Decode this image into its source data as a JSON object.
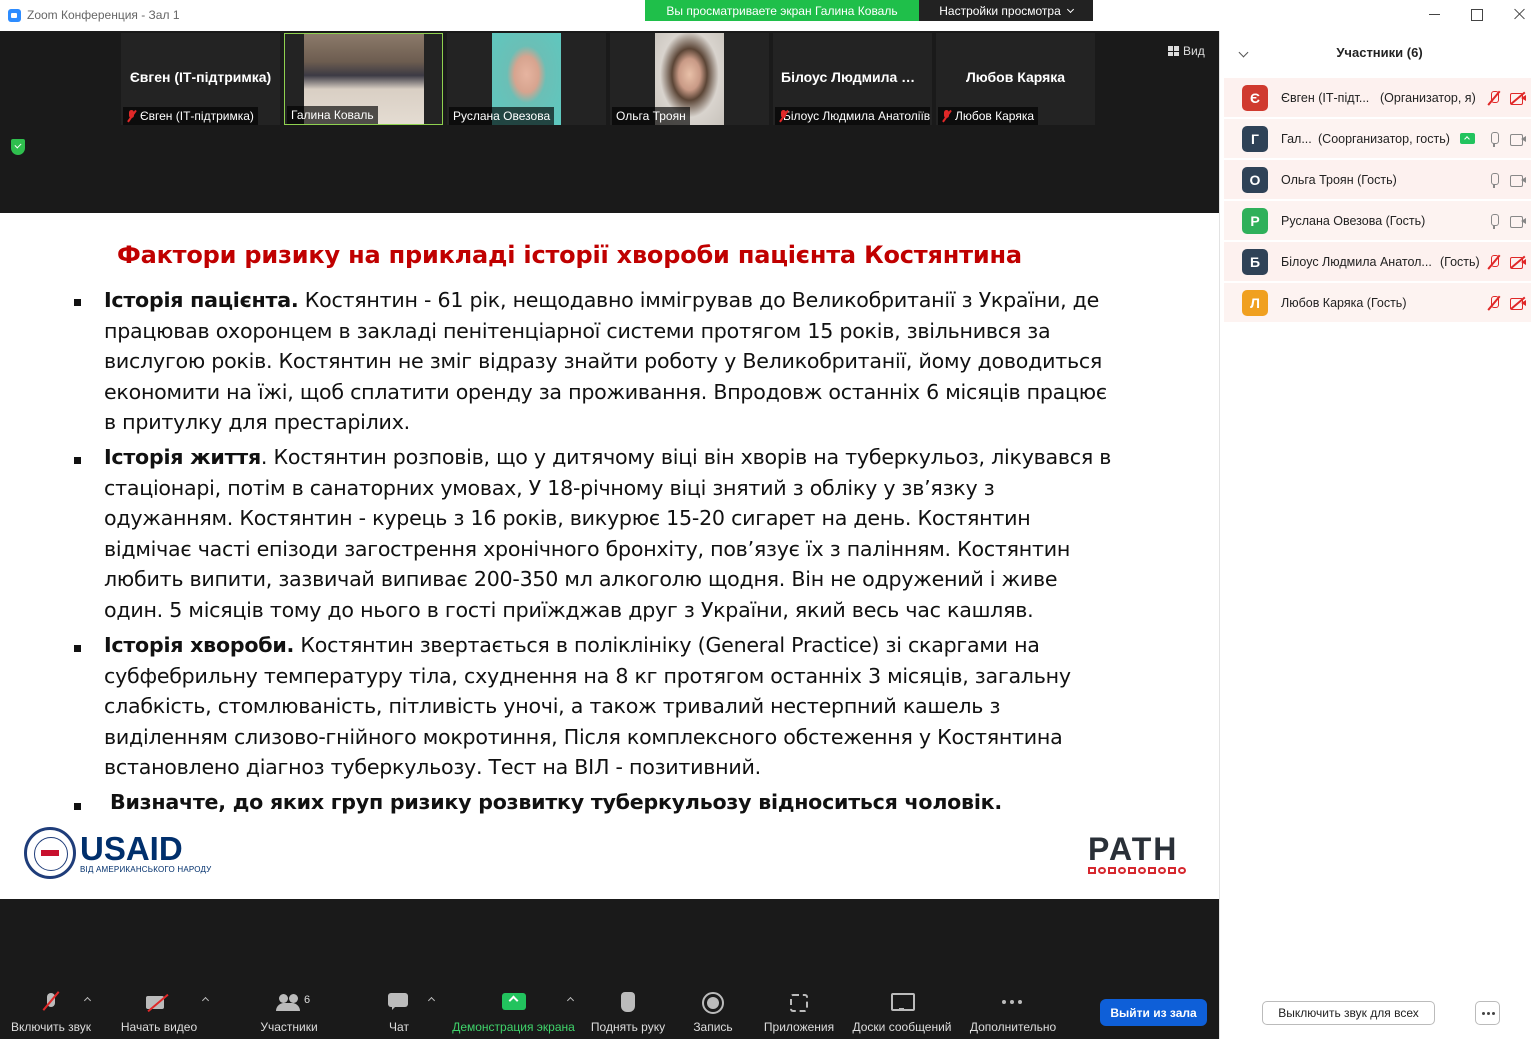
{
  "window": {
    "title": "Zoom Конференция - Зал 1",
    "share_banner": "Вы просматриваете экран Галина Коваль",
    "view_settings": "Настройки просмотра",
    "view_button": "Вид"
  },
  "video_tiles": [
    {
      "big_name": "Євген (ІТ-підтримка)",
      "label": "Євген (ІТ-підтримка)",
      "muted": true,
      "photo": false
    },
    {
      "big_name": "",
      "label": "Галина Коваль",
      "muted": false,
      "photo": true,
      "active": true
    },
    {
      "big_name": "",
      "label": "Руслана Овезова",
      "muted": false,
      "photo": true
    },
    {
      "big_name": "",
      "label": "Ольга Троян",
      "muted": false,
      "photo": true
    },
    {
      "big_name": "Білоус Людмила Анатоліївна",
      "label": "Білоус Людмила Анатоліївна",
      "muted": true,
      "photo": false
    },
    {
      "big_name": "Любов Каряка",
      "label": "Любов Каряка",
      "muted": true,
      "photo": false
    }
  ],
  "slide": {
    "title": "Фактори ризику на прикладі історії хвороби пацієнта Костянтина",
    "p1_bold": "Історія пацієнта.",
    "p1_text": " Костянтин - 61 рік, нещодавно іммігрував до Великобританії з України, де працював охоронцем в закладі пенітенціарної системи протягом 15 років, звільнився за вислугою років. Костянтин не зміг відразу знайти роботу у Великобританії, йому доводиться економити на їжі, щоб сплатити оренду за проживання. Впродовж останніх 6 місяців працює в притулку для престарілих.",
    "p2_bold": "Історія життя",
    "p2_text": ". Костянтин розповів, що у дитячому віці він хворів на туберкульоз, лікувався в стаціонарі, потім в санаторних умовах, У 18-річному віці знятий з обліку у зв’язку з одужанням. Костянтин - курець з 16 років, викурює 15-20 сигарет на день. Костянтин відмічає часті епізоди загострення хронічного бронхіту, пов’язує їх з палінням.  Костянтин любить випити, зазвичай випиває 200-350 мл алкоголю щодня. Він не одружений і живе один. 5 місяців тому до нього в гості приїжджав друг з України, який весь час кашляв.",
    "p3_bold": "Історія хвороби.",
    "p3_text": " Костянтин звертається в поліклініку (General Practice) зі скаргами на субфебрильну температуру тіла, схуднення на 8 кг протягом останніх 3 місяців, загальну слабкість, стомлюваність, пітливість уночі, а також тривалий нестерпний кашель з виділенням слизово-гнійного мокротиння, Після комплексного обстеження у Костянтина встановлено діагноз туберкульозу. Тест на ВІЛ - позитивний.",
    "question": "Визначте, до яких  груп ризику розвитку туберкульозу відноситься чоловік.",
    "usaid_word": "USAID",
    "usaid_sub": "ВІД АМЕРИКАНСЬКОГО НАРОДУ",
    "path_word": "PATH"
  },
  "toolbar": {
    "mic": "Включить звук",
    "video": "Начать видео",
    "participants": "Участники",
    "participants_count": "6",
    "chat": "Чат",
    "share": "Демонстрация экрана",
    "raise_hand": "Поднять руку",
    "record": "Запись",
    "apps": "Приложения",
    "whiteboards": "Доски сообщений",
    "more": "Дополнительно",
    "leave": "Выйти из зала"
  },
  "panel": {
    "title": "Участники (6)",
    "participants": [
      {
        "initial": "Є",
        "name": "Євген (ІТ-підт...",
        "role": "(Организатор, я)",
        "color": "#d03a2f",
        "mic": "muted",
        "cam": "muted"
      },
      {
        "initial": "Г",
        "name": "Гал...",
        "role": "(Соорганизатор, гость)",
        "color": "#2f4257",
        "mic": "on",
        "cam": "on",
        "sharing": true
      },
      {
        "initial": "О",
        "name": "Ольга Троян (Гость)",
        "role": "",
        "color": "#2f4257",
        "mic": "on",
        "cam": "on"
      },
      {
        "initial": "Р",
        "name": "Руслана Овезова (Гость)",
        "role": "",
        "color": "#2fb05a",
        "mic": "on",
        "cam": "on"
      },
      {
        "initial": "Б",
        "name": "Білоус Людмила Анатол...",
        "role": "(Гость)",
        "color": "#2f4257",
        "mic": "muted",
        "cam": "muted"
      },
      {
        "initial": "Л",
        "name": "Любов Каряка (Гость)",
        "role": "",
        "color": "#f0a020",
        "mic": "muted",
        "cam": "muted"
      }
    ],
    "mute_all": "Выключить звук для всех"
  }
}
